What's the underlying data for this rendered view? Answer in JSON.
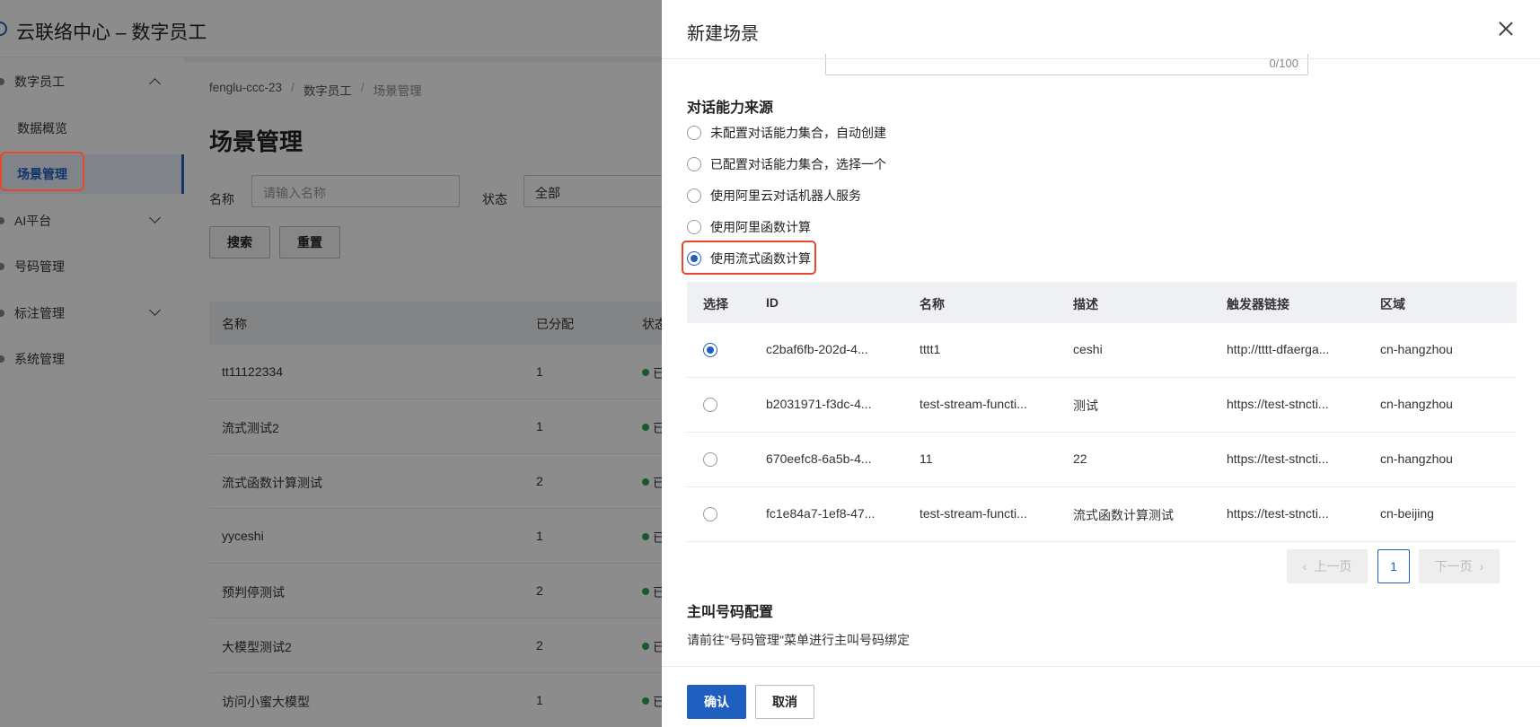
{
  "app": {
    "title": "云联络中心 – 数字员工"
  },
  "sidebar": {
    "items": [
      {
        "label": "数字员工",
        "expanded": true
      },
      {
        "label": "数据概览"
      },
      {
        "label": "场景管理",
        "active": true
      },
      {
        "label": "AI平台",
        "expanded": false
      },
      {
        "label": "号码管理"
      },
      {
        "label": "标注管理",
        "expanded": false
      },
      {
        "label": "系统管理"
      }
    ]
  },
  "breadcrumb": [
    "fenglu-ccc-23",
    "数字员工",
    "场景管理"
  ],
  "page": {
    "title": "场景管理",
    "filter": {
      "name_label": "名称",
      "name_placeholder": "请输入名称",
      "status_label": "状态",
      "status_value": "全部"
    },
    "buttons": {
      "search": "搜索",
      "reset": "重置"
    },
    "table": {
      "columns": [
        "名称",
        "已分配",
        "状态"
      ],
      "rows": [
        {
          "name": "tt11122334",
          "assigned": "1",
          "status": "已"
        },
        {
          "name": "流式测试2",
          "assigned": "1",
          "status": "已"
        },
        {
          "name": "流式函数计算测试",
          "assigned": "2",
          "status": "已"
        },
        {
          "name": "yyceshi",
          "assigned": "1",
          "status": "已"
        },
        {
          "name": "预判停测试",
          "assigned": "2",
          "status": "已"
        },
        {
          "name": "大模型测试2",
          "assigned": "2",
          "status": "已"
        },
        {
          "name": "访问小蜜大模型",
          "assigned": "1",
          "status": "已"
        }
      ]
    }
  },
  "drawer": {
    "title": "新建场景",
    "counter": "0/100",
    "dialog_source": {
      "title": "对话能力来源",
      "options": [
        {
          "label": "未配置对话能力集合，自动创建",
          "checked": false
        },
        {
          "label": "已配置对话能力集合，选择一个",
          "checked": false
        },
        {
          "label": "使用阿里云对话机器人服务",
          "checked": false
        },
        {
          "label": "使用阿里函数计算",
          "checked": false
        },
        {
          "label": "使用流式函数计算",
          "checked": true
        }
      ]
    },
    "function_table": {
      "columns": [
        "选择",
        "ID",
        "名称",
        "描述",
        "触发器链接",
        "区域"
      ],
      "rows": [
        {
          "selected": true,
          "id": "c2baf6fb-202d-4...",
          "name": "tttt1",
          "desc": "ceshi",
          "trigger": "http://tttt-dfaerga...",
          "region": "cn-hangzhou"
        },
        {
          "selected": false,
          "id": "b2031971-f3dc-4...",
          "name": "test-stream-functi...",
          "desc": "测试",
          "trigger": "https://test-stncti...",
          "region": "cn-hangzhou"
        },
        {
          "selected": false,
          "id": "670eefc8-6a5b-4...",
          "name": "11",
          "desc": "22",
          "trigger": "https://test-stncti...",
          "region": "cn-hangzhou"
        },
        {
          "selected": false,
          "id": "fc1e84a7-1ef8-47...",
          "name": "test-stream-functi...",
          "desc": "流式函数计算测试",
          "trigger": "https://test-stncti...",
          "region": "cn-beijing"
        }
      ]
    },
    "pagination": {
      "prev": "上一页",
      "current": "1",
      "next": "下一页"
    },
    "caller_section": {
      "title": "主叫号码配置",
      "hint": "请前往\"号码管理\"菜单进行主叫号码绑定"
    },
    "footer": {
      "confirm": "确认",
      "cancel": "取消"
    }
  },
  "colors": {
    "primary": "#1f5fbf",
    "highlight": "#e8462d",
    "status_ok": "#2ea44f"
  }
}
